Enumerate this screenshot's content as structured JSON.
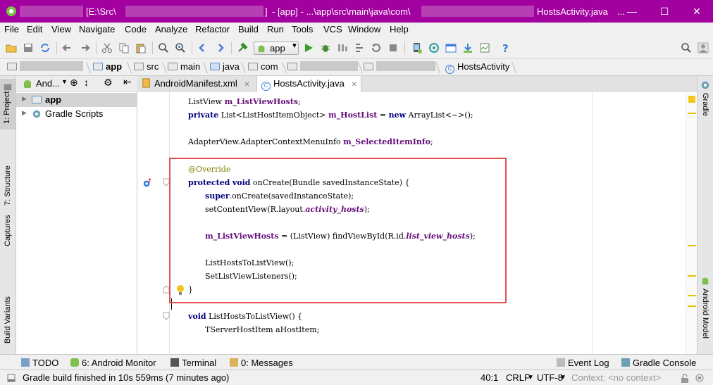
{
  "title": {
    "path_open": "[E:\\Src\\",
    "path_close": "]",
    "module": "- [app] - ...\\app\\src\\main\\java\\com\\",
    "file": "HostsActivity.java",
    "more": "..."
  },
  "menu": [
    "File",
    "Edit",
    "View",
    "Navigate",
    "Code",
    "Analyze",
    "Refactor",
    "Build",
    "Run",
    "Tools",
    "VCS",
    "Window",
    "Help"
  ],
  "toolbar": {
    "run_config": "app"
  },
  "nav": {
    "app": "app",
    "src": "src",
    "main": "main",
    "java": "java",
    "com": "com",
    "class": "HostsActivity"
  },
  "project_panel": {
    "view_selector": "And...",
    "items": [
      "app",
      "Gradle Scripts"
    ]
  },
  "tabs": [
    "AndroidManifest.xml",
    "HostsActivity.java"
  ],
  "code": [
    [
      "ListView ",
      "m_ListViewHosts",
      ";"
    ],
    [
      "private",
      " List<ListHostItemObject> ",
      "m_HostList",
      " = ",
      "new",
      " ArrayList<~>();"
    ],
    [
      "AdapterView.AdapterContextMenuInfo ",
      "m_SelectedItemInfo",
      ";"
    ],
    [
      "@Override"
    ],
    [
      "protected",
      " ",
      "void",
      " onCreate(Bundle savedInstanceState) {"
    ],
    [
      "super",
      ".onCreate(savedInstanceState);"
    ],
    [
      "setContentView(R.layout.",
      "activity_hosts",
      ");"
    ],
    [
      "m_ListViewHosts",
      " = (ListView) findViewById(R.id.",
      "list_view_hosts",
      ");"
    ],
    [
      "ListHostsToListView();"
    ],
    [
      "SetListViewListeners();"
    ],
    [
      "}"
    ],
    [
      "void",
      " ListHostsToListView() {"
    ],
    [
      "TServerHostItem aHostItem;"
    ]
  ],
  "side_left": [
    "1: Project",
    "7: Structure",
    "Captures",
    "Build Variants"
  ],
  "side_right": [
    "Gradle",
    "Android Model"
  ],
  "bottom_tabs": [
    "TODO",
    "6: Android Monitor",
    "Terminal",
    "0: Messages",
    "Event Log",
    "Gradle Console"
  ],
  "status": {
    "message": "Gradle build finished in 10s 559ms (7 minutes ago)",
    "position": "40:1",
    "line_sep": "CRLF",
    "encoding": "UTF-8",
    "context": "Context: <no context>"
  },
  "colors": {
    "title_bar": "#a2009f",
    "highlight_box": "#e0534f",
    "keyword": "#000080",
    "field": "#660e7a",
    "annotation": "#808000"
  }
}
